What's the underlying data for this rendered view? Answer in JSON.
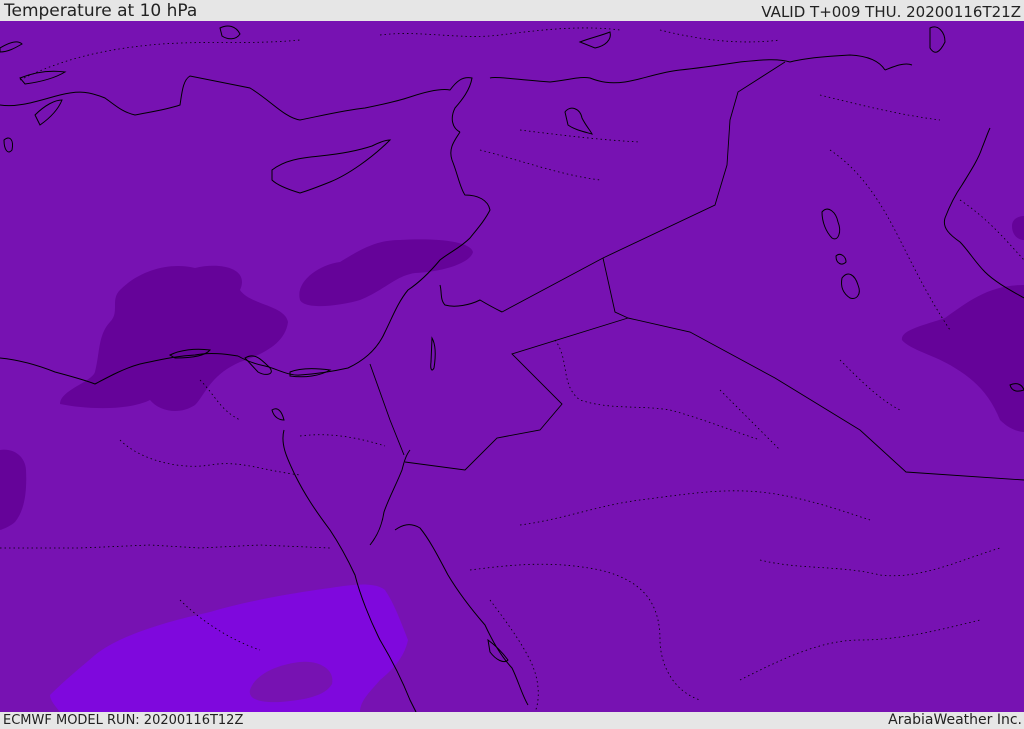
{
  "header": {
    "title": "Temperature at 10 hPa",
    "valid": "VALID T+009 THU. 20200116T21Z"
  },
  "footer": {
    "run": "ECMWF MODEL RUN: 20200116T12Z",
    "credit": "ArabiaWeather Inc."
  },
  "colors": {
    "base_field": "#7712b2",
    "cold_band": "#650399",
    "warm_band": "#7f08dd",
    "coastline": "#000000"
  }
}
